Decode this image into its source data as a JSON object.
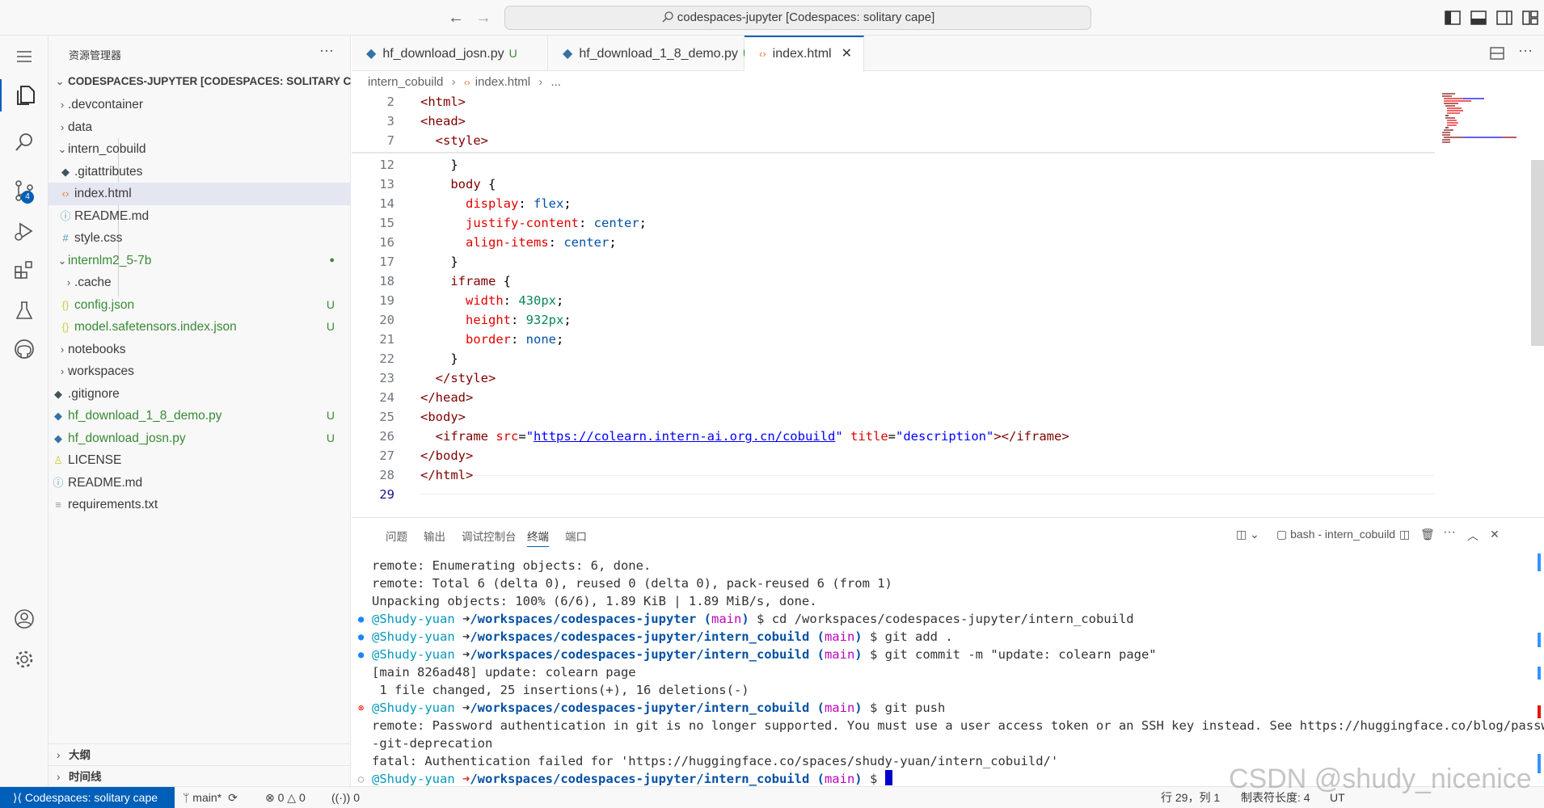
{
  "titlebar": {
    "command_center": "codespaces-jupyter [Codespaces: solitary cape]"
  },
  "activity_bar": {
    "scm_badge": "4"
  },
  "sidebar": {
    "title": "资源管理器",
    "more": "···",
    "root": "CODESPACES-JUPYTER [CODESPACES: SOLITARY CA...",
    "items": [
      {
        "label": ".devcontainer",
        "status": ""
      },
      {
        "label": "data",
        "status": ""
      },
      {
        "label": "intern_cobuild",
        "status": ""
      },
      {
        "label": ".gitattributes",
        "status": ""
      },
      {
        "label": "index.html",
        "status": ""
      },
      {
        "label": "README.md",
        "status": ""
      },
      {
        "label": "style.css",
        "status": ""
      },
      {
        "label": "internlm2_5-7b",
        "status": "●"
      },
      {
        "label": ".cache",
        "status": ""
      },
      {
        "label": "config.json",
        "status": "U"
      },
      {
        "label": "model.safetensors.index.json",
        "status": "U"
      },
      {
        "label": "notebooks",
        "status": ""
      },
      {
        "label": "workspaces",
        "status": ""
      },
      {
        "label": ".gitignore",
        "status": ""
      },
      {
        "label": "hf_download_1_8_demo.py",
        "status": "U"
      },
      {
        "label": "hf_download_josn.py",
        "status": "U"
      },
      {
        "label": "LICENSE",
        "status": ""
      },
      {
        "label": "README.md",
        "status": ""
      },
      {
        "label": "requirements.txt",
        "status": ""
      }
    ],
    "outline": "大纲",
    "timeline": "时间线"
  },
  "tabs": [
    {
      "label": "hf_download_josn.py",
      "status": "U"
    },
    {
      "label": "hf_download_1_8_demo.py",
      "status": "U"
    },
    {
      "label": "index.html",
      "status": ""
    }
  ],
  "breadcrumb": {
    "folder": "intern_cobuild",
    "file": "index.html",
    "more": "..."
  },
  "editor": {
    "line_numbers": [
      "2",
      "3",
      "7",
      "12",
      "13",
      "14",
      "15",
      "16",
      "17",
      "18",
      "19",
      "20",
      "21",
      "22",
      "23",
      "24",
      "25",
      "26",
      "27",
      "28",
      "29"
    ]
  },
  "panel": {
    "tabs": [
      "问题",
      "输出",
      "调试控制台",
      "终端",
      "端口"
    ],
    "terminal_name": "bash - intern_cobuild",
    "terminal": {
      "l1": "remote: Enumerating objects: 6, done.",
      "l2": "remote: Total 6 (delta 0), reused 0 (delta 0), pack-reused 6 (from 1)",
      "l3": "Unpacking objects: 100% (6/6), 1.89 KiB | 1.89 MiB/s, done.",
      "user": "@Shudy-yuan",
      "arrow": "➜",
      "path1": "/workspaces/codespaces-jupyter",
      "path2": "/workspaces/codespaces-jupyter/intern_cobuild",
      "branch_open": "(",
      "branch": "main",
      "branch_close": ")",
      "dollar": "$",
      "cmd1": "cd /workspaces/codespaces-jupyter/intern_cobuild",
      "cmd2": "git add .",
      "cmd3": "git commit -m \"update: colearn page\"",
      "l7": "[main 826ad48] update: colearn page",
      "l8": " 1 file changed, 25 insertions(+), 16 deletions(-)",
      "cmd4": "git push",
      "l10": "remote: Password authentication in git is no longer supported. You must use a user access token or an SSH key instead. See https://huggingface.co/blog/password",
      "l11": "-git-deprecation",
      "l12": "fatal: Authentication failed for 'https://huggingface.co/spaces/shudy-yuan/intern_cobuild/'"
    }
  },
  "statusbar": {
    "remote": "Codespaces: solitary cape",
    "branch": "main*",
    "errors": "0",
    "warnings": "0",
    "ports": "0",
    "position": "行 29，列 1",
    "tab_size": "制表符长度: 4",
    "encoding": "UT"
  },
  "watermark": "CSDN @shudy_nicenice"
}
